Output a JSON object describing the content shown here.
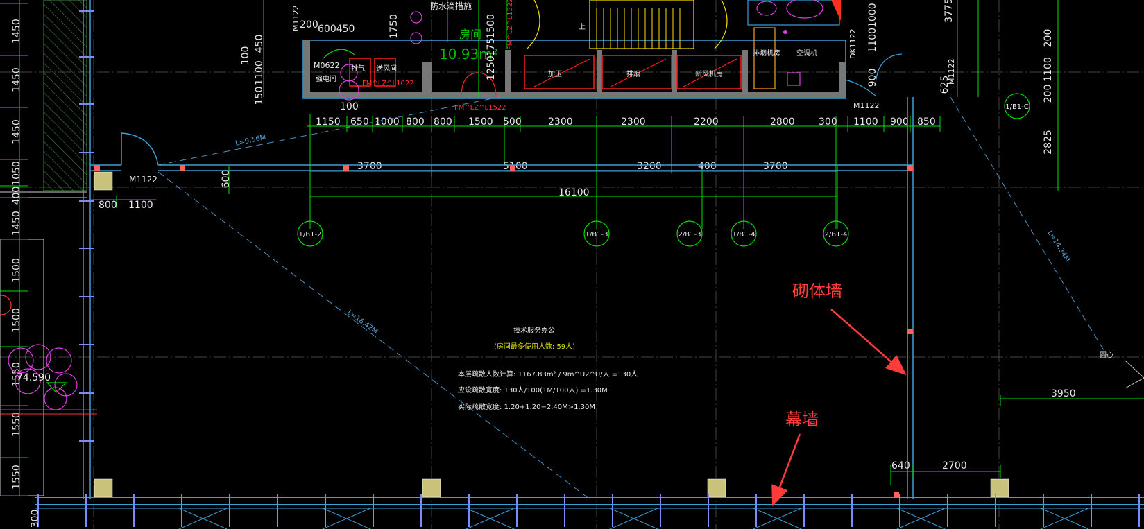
{
  "top_dims": [
    "1150",
    "650",
    "1000",
    "800",
    "800",
    "1500",
    "500",
    "2300",
    "2300",
    "2200",
    "2800",
    "300",
    "1100",
    "900",
    "850"
  ],
  "mid_dims": [
    "3700",
    "5100",
    "3200",
    "400",
    "3700"
  ],
  "total_dim": "16100",
  "left_dims": [
    "1450",
    "1450",
    "1450",
    "1050",
    "400",
    "1450",
    "1500",
    "1500",
    "1550",
    "1550",
    "1550"
  ],
  "right_top_dims": [
    "3775",
    "200",
    "200",
    "1100",
    "2825"
  ],
  "axes": {
    "b1_2": "1/B1-2",
    "b1_3": "1/B1-3",
    "b2_3": "2/B1-3",
    "b1_4": "1/B1-4",
    "b2_4": "2/B1-4",
    "b1_c": "1/B1-C"
  },
  "doors": {
    "m1122_left": "M1122",
    "m1122_right": "M1122",
    "m1122_top": "M1122",
    "m0622": "M0622",
    "fm_1022": "FM^LZ^L1022",
    "fm_1522": "FM^LZ^L1522",
    "fm_v": "FM^LZ^L1522",
    "dk1122": "DK1122",
    "m1122_r2": "M1122"
  },
  "dims_misc": {
    "d800": "800",
    "d1100": "1100",
    "d600": "600",
    "d100": "100",
    "d200": "200",
    "d600450": "600450",
    "d1750": "1750",
    "d1500": "1500",
    "d1250": "1250",
    "d175": "175",
    "d900": "900",
    "d625": "625",
    "d3950": "3950",
    "d640": "640",
    "d2700": "2700",
    "d300b": "300",
    "d100v": "100",
    "d450v": "450",
    "d1100v": "1100",
    "d150v": "150",
    "d1100v2": "11001000"
  },
  "elevation": "74.590",
  "room_text": {
    "waterproof": "防水滴措施",
    "room": "房间",
    "area": "10.93m²",
    "shang": "上"
  },
  "room_labels": {
    "r1": "加压",
    "r2": "排烟",
    "r3": "新风机房",
    "r4": "排烟机房",
    "r5": "空调机",
    "r6": "强电间",
    "r7": "排气",
    "r8": "送风间"
  },
  "notes": {
    "title": "技术服务办公",
    "subtitle": "(房间最多使用人数: 59人)",
    "line1": "本层疏散人数计算: 1167.83m² / 9m^U2^U/人 =130人",
    "line2": "应设疏散宽度: 130人/100(1M/100人) =1.30M",
    "line3": "实际疏散宽度: 1.20+1.20=2.40M>1.30M"
  },
  "dist_labels": {
    "l1": "L=9.56M",
    "l2": "L=16.42M",
    "l3": "L=14.34M",
    "yuanxin": "圆心"
  },
  "annotations": {
    "masonry": "砌体墙",
    "curtain": "幕墙"
  },
  "colors": {
    "wall": "#3aa0d8",
    "dim": "#00e000",
    "grid": "#4a4a4a",
    "red": "#ff2020",
    "yellow": "#ffe000",
    "magenta": "#ff00ff",
    "annotation": "#ff3b3b"
  }
}
